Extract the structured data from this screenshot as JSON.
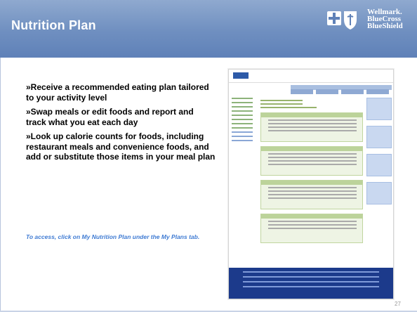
{
  "slide": {
    "title": "Nutrition Plan",
    "brand": {
      "line1": "Wellmark.",
      "line2": "BlueCross",
      "line3": "BlueShield"
    },
    "bullets": [
      "»Receive a recommended eating plan tailored to your activity level",
      "»Swap meals or edit foods and report and track what you eat each day",
      "»Look up calorie counts for foods, including restaurant meals and convenience foods, and add or substitute those items in your meal plan"
    ],
    "note": "To access, click on My Nutrition Plan under the My Plans tab.",
    "page_number": "27"
  },
  "colors": {
    "header": "#6f8fc0",
    "note": "#3f7bd3",
    "footer": "#1c3a8b"
  }
}
